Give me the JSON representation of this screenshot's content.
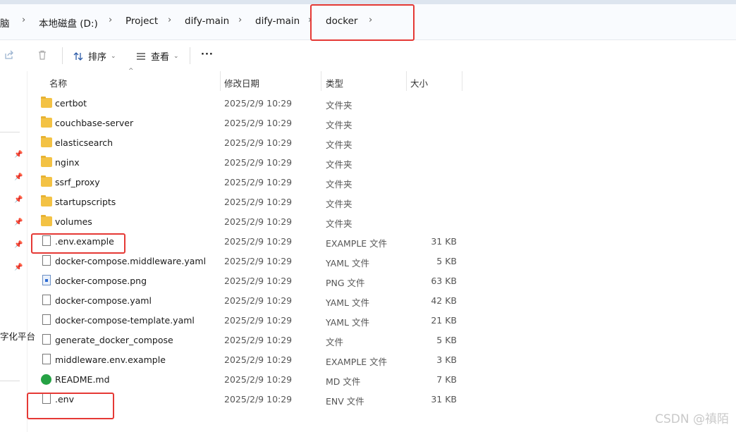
{
  "breadcrumbs": [
    "脑",
    "本地磁盘 (D:)",
    "Project",
    "dify-main",
    "dify-main",
    "docker"
  ],
  "toolbar": {
    "sort_label": "排序",
    "view_label": "查看",
    "more_label": "···"
  },
  "nav": {
    "partial_text": "字化平台"
  },
  "columns": {
    "name": "名称",
    "modified": "修改日期",
    "type": "类型",
    "size": "大小"
  },
  "files": [
    {
      "name": "certbot",
      "modified": "2025/2/9 10:29",
      "type": "文件夹",
      "size": "",
      "icon": "folder-icon"
    },
    {
      "name": "couchbase-server",
      "modified": "2025/2/9 10:29",
      "type": "文件夹",
      "size": "",
      "icon": "folder-icon"
    },
    {
      "name": "elasticsearch",
      "modified": "2025/2/9 10:29",
      "type": "文件夹",
      "size": "",
      "icon": "folder-icon"
    },
    {
      "name": "nginx",
      "modified": "2025/2/9 10:29",
      "type": "文件夹",
      "size": "",
      "icon": "folder-icon"
    },
    {
      "name": "ssrf_proxy",
      "modified": "2025/2/9 10:29",
      "type": "文件夹",
      "size": "",
      "icon": "folder-icon"
    },
    {
      "name": "startupscripts",
      "modified": "2025/2/9 10:29",
      "type": "文件夹",
      "size": "",
      "icon": "folder-icon"
    },
    {
      "name": "volumes",
      "modified": "2025/2/9 10:29",
      "type": "文件夹",
      "size": "",
      "icon": "folder-icon"
    },
    {
      "name": ".env.example",
      "modified": "2025/2/9 10:29",
      "type": "EXAMPLE 文件",
      "size": "31 KB",
      "icon": "file-icon"
    },
    {
      "name": "docker-compose.middleware.yaml",
      "modified": "2025/2/9 10:29",
      "type": "YAML 文件",
      "size": "5 KB",
      "icon": "file-icon"
    },
    {
      "name": "docker-compose.png",
      "modified": "2025/2/9 10:29",
      "type": "PNG 文件",
      "size": "63 KB",
      "icon": "image-file-icon"
    },
    {
      "name": "docker-compose.yaml",
      "modified": "2025/2/9 10:29",
      "type": "YAML 文件",
      "size": "42 KB",
      "icon": "file-icon"
    },
    {
      "name": "docker-compose-template.yaml",
      "modified": "2025/2/9 10:29",
      "type": "YAML 文件",
      "size": "21 KB",
      "icon": "file-icon"
    },
    {
      "name": "generate_docker_compose",
      "modified": "2025/2/9 10:29",
      "type": "文件",
      "size": "5 KB",
      "icon": "file-icon"
    },
    {
      "name": "middleware.env.example",
      "modified": "2025/2/9 10:29",
      "type": "EXAMPLE 文件",
      "size": "3 KB",
      "icon": "file-icon"
    },
    {
      "name": "README.md",
      "modified": "2025/2/9 10:29",
      "type": "MD 文件",
      "size": "7 KB",
      "icon": "markdown-file-icon"
    },
    {
      "name": ".env",
      "modified": "2025/2/9 10:29",
      "type": "ENV 文件",
      "size": "31 KB",
      "icon": "file-icon"
    }
  ],
  "watermark": "CSDN @禛陌",
  "colors": {
    "folder": "#f3c244",
    "highlight": "#e53935",
    "address_bg": "#f9fbfe"
  }
}
